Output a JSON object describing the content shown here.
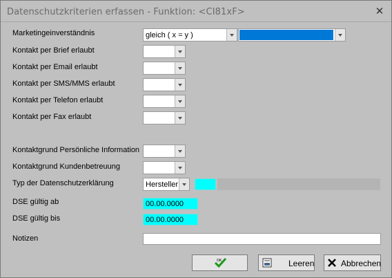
{
  "window": {
    "title": "Datenschutzkriterien erfassen - Funktion: <CI81xF>"
  },
  "form": {
    "marketing": {
      "label": "Marketingeinverständnis",
      "operator": "gleich ( x = y )",
      "value": ""
    },
    "rows": [
      {
        "label": "Kontakt per Brief erlaubt",
        "value": ""
      },
      {
        "label": "Kontakt per Email erlaubt",
        "value": ""
      },
      {
        "label": "Kontakt per SMS/MMS erlaubt",
        "value": ""
      },
      {
        "label": "Kontakt per Telefon erlaubt",
        "value": ""
      },
      {
        "label": "Kontakt per Fax erlaubt",
        "value": ""
      }
    ],
    "kontaktgrund": [
      {
        "label": "Kontaktgrund Persönliche Information",
        "value": ""
      },
      {
        "label": "Kontaktgrund Kundenbetreuung",
        "value": ""
      }
    ],
    "typ": {
      "label": "Typ der Datenschutzerklärung",
      "value": "Hersteller",
      "code": "",
      "description": ""
    },
    "dse_ab": {
      "label": "DSE gültig ab",
      "value": "00.00.0000"
    },
    "dse_bis": {
      "label": "DSE gültig bis",
      "value": "00.00.0000"
    },
    "notizen": {
      "label": "Notizen",
      "value": ""
    }
  },
  "buttons": {
    "ok_label": "",
    "leeren_label": "Leeren",
    "abbrechen_label": "Abbrechen"
  },
  "icons": {
    "close": "close-icon",
    "ok": "ok-checkmark-icon",
    "leeren": "clear-form-icon",
    "abbrechen": "cancel-x-icon"
  },
  "colors": {
    "accent": "#0078d7",
    "mandatory": "#00ffff",
    "ok_check": "#1a9a1a"
  }
}
